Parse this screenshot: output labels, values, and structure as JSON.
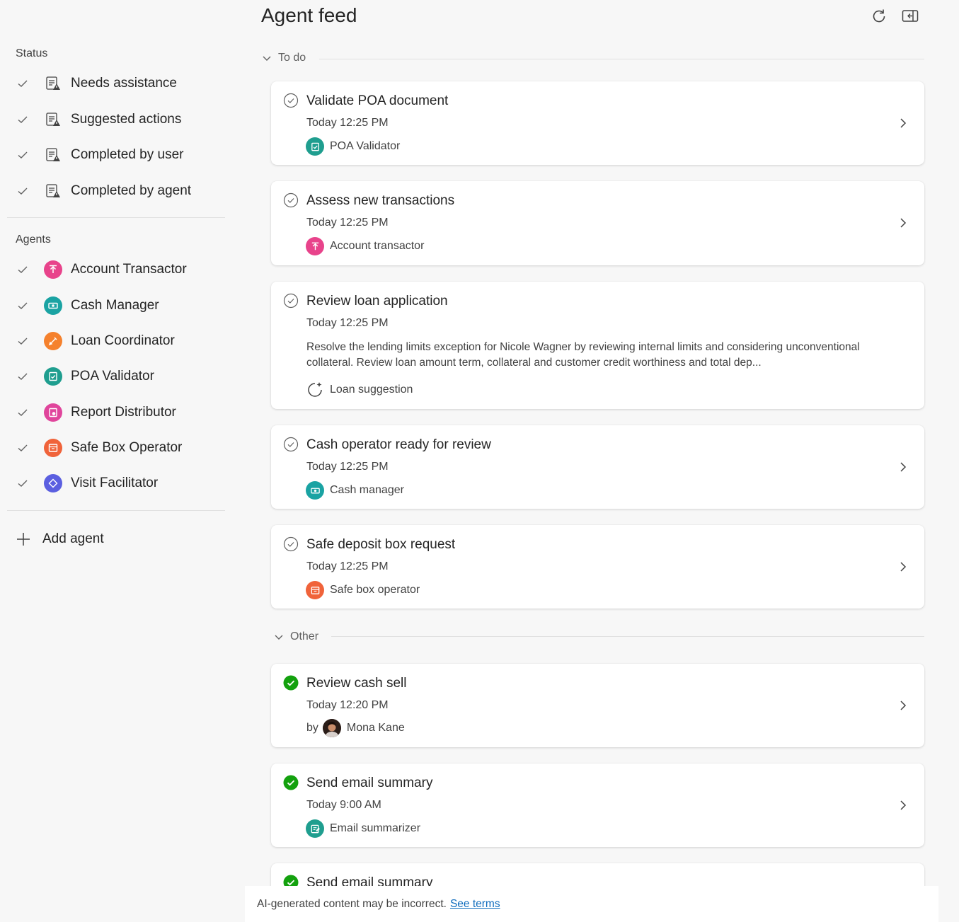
{
  "sidebar": {
    "status_heading": "Status",
    "status_items": [
      {
        "label": "Needs assistance",
        "icon": "task-list-warning-icon"
      },
      {
        "label": "Suggested actions",
        "icon": "task-list-warning-icon"
      },
      {
        "label": "Completed by user",
        "icon": "task-list-warning-icon"
      },
      {
        "label": "Completed by agent",
        "icon": "task-list-warning-icon"
      }
    ],
    "agents_heading": "Agents",
    "agent_items": [
      {
        "label": "Account Transactor",
        "color": "#e8438b"
      },
      {
        "label": "Cash Manager",
        "color": "#1aa3a3"
      },
      {
        "label": "Loan Coordinator",
        "color": "#f5812d"
      },
      {
        "label": "POA Validator",
        "color": "#1f9e8f"
      },
      {
        "label": "Report Distributor",
        "color": "#e0459c"
      },
      {
        "label": "Safe Box Operator",
        "color": "#f0633a"
      },
      {
        "label": "Visit Facilitator",
        "color": "#5b5fe0"
      }
    ],
    "add_agent_label": "Add agent"
  },
  "main": {
    "title": "Agent feed",
    "sections": {
      "todo_label": "To do",
      "other_label": "Other"
    },
    "todo_cards": [
      {
        "title": "Validate POA document",
        "time": "Today 12:25 PM",
        "agent": "POA Validator",
        "agent_color": "#1f9e8f"
      },
      {
        "title": "Assess new transactions",
        "time": "Today 12:25 PM",
        "agent": "Account transactor",
        "agent_color": "#e8438b"
      },
      {
        "title": "Review loan application",
        "time": "Today 12:25 PM",
        "description": "Resolve the lending limits exception for Nicole Wagner by reviewing internal limits and considering unconventional collateral. Review loan amount term, collateral and customer credit worthiness and total dep...",
        "agent": "Loan suggestion"
      },
      {
        "title": "Cash operator ready for review",
        "time": "Today 12:25 PM",
        "agent": "Cash manager",
        "agent_color": "#1aa3a3"
      },
      {
        "title": "Safe deposit box request",
        "time": "Today 12:25 PM",
        "agent": "Safe box operator",
        "agent_color": "#f0633a"
      }
    ],
    "other_cards": [
      {
        "title": "Review cash sell",
        "time": "Today 12:20 PM",
        "by_label": "by",
        "agent": "Mona Kane"
      },
      {
        "title": "Send email summary",
        "time": "Today 9:00 AM",
        "agent": "Email summarizer",
        "agent_color": "#1f9e8f"
      },
      {
        "title": "Send email summary"
      }
    ]
  },
  "footer": {
    "disclaimer": "AI-generated content may be incorrect.",
    "link": "See terms"
  },
  "colors": {
    "success": "#13a10e",
    "link": "#0f6cbd"
  }
}
